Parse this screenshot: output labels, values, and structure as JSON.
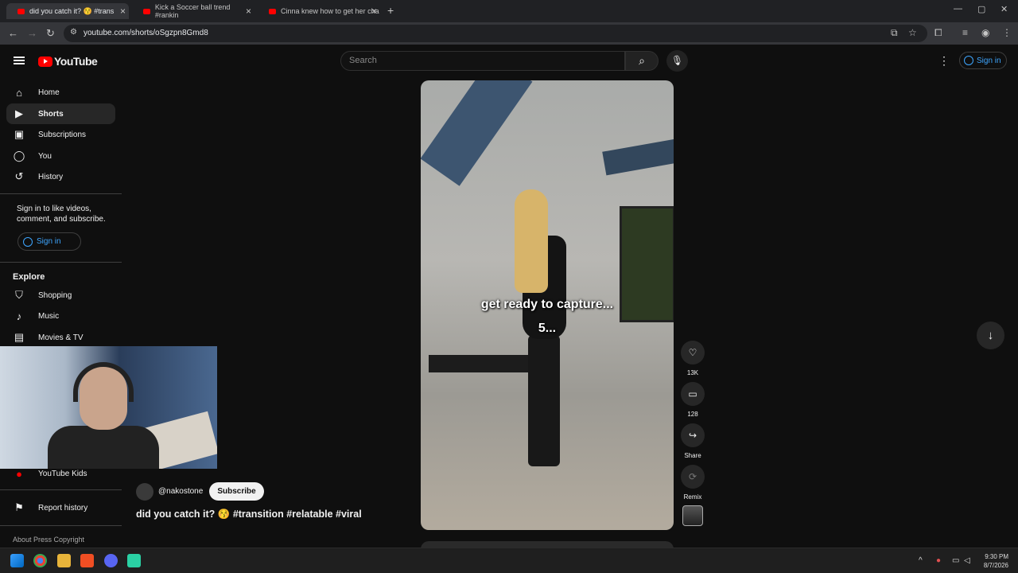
{
  "browser": {
    "tabs": [
      {
        "title": "did you catch it? 😚 #trans",
        "active": true
      },
      {
        "title": "Kick a Soccer ball trend #rankin",
        "active": false
      },
      {
        "title": "Cinna knew how to get her cha",
        "active": false
      }
    ],
    "url": "youtube.com/shorts/oSgzpn8Gmd8"
  },
  "header": {
    "logo_text": "YouTube",
    "search_placeholder": "Search",
    "signin_label": "Sign in"
  },
  "sidebar": {
    "items": [
      {
        "label": "Home",
        "icon": "home-icon"
      },
      {
        "label": "Shorts",
        "icon": "shorts-icon"
      },
      {
        "label": "Subscriptions",
        "icon": "subscriptions-icon"
      },
      {
        "label": "You",
        "icon": "user-icon"
      },
      {
        "label": "History",
        "icon": "history-icon"
      }
    ],
    "signin_prompt": [
      "Sign in to like videos,",
      "comment, and subscribe."
    ],
    "signin_label": "Sign in",
    "explore_title": "Explore",
    "explore_items": [
      {
        "label": "Shopping",
        "icon": "shopping-icon"
      },
      {
        "label": "Music",
        "icon": "music-icon"
      },
      {
        "label": "Movies & TV",
        "icon": "movies-icon"
      }
    ],
    "kids_label": "YouTube Kids",
    "report_label": "Report history",
    "footer": "About  Press  Copyright"
  },
  "short": {
    "captions": [
      "get ready to capture...",
      "5..."
    ],
    "channel": "@nakostone",
    "subscribe_label": "Subscribe",
    "title": "did you catch it? 😚 #transition #relatable #viral",
    "actions": {
      "likes": "13K",
      "comments": "128",
      "share": "Share",
      "remix": "Remix"
    }
  },
  "taskbar": {
    "time": "9:30 PM",
    "date": "8/7/2026"
  }
}
